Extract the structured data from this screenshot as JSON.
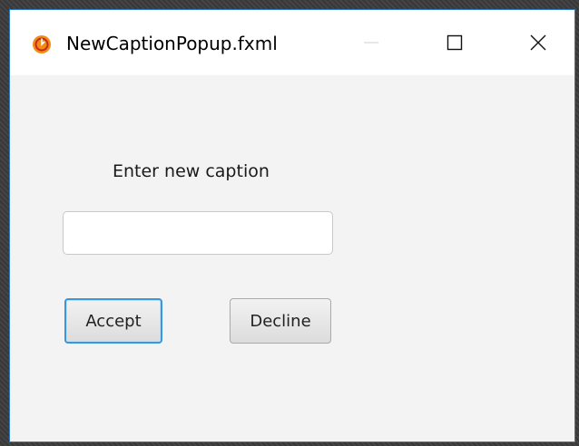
{
  "window": {
    "title": "NewCaptionPopup.fxml",
    "controls": {
      "minimize": "minimize-icon",
      "maximize": "maximize-icon",
      "close": "close-icon"
    },
    "app_icon": "javafx-app-icon"
  },
  "form": {
    "label": "Enter new caption",
    "input_value": "",
    "accept_label": "Accept",
    "decline_label": "Decline"
  },
  "colors": {
    "accent": "#3a96dd",
    "window_border": "#2b79c9",
    "app_icon": "#f28c18"
  }
}
